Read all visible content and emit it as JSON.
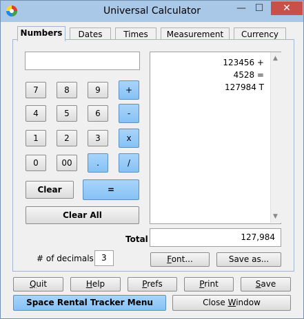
{
  "window": {
    "title": "Universal Calculator",
    "minimize_glyph": "—",
    "maximize_glyph": "☐",
    "close_glyph": "✕"
  },
  "tabs": [
    {
      "label": "Numbers",
      "active": true
    },
    {
      "label": "Dates",
      "active": false
    },
    {
      "label": "Times",
      "active": false
    },
    {
      "label": "Measurement",
      "active": false
    },
    {
      "label": "Currency",
      "active": false
    }
  ],
  "entry": {
    "value": ""
  },
  "keypad": {
    "k7": "7",
    "k8": "8",
    "k9": "9",
    "plus": "+",
    "k4": "4",
    "k5": "5",
    "k6": "6",
    "minus": "-",
    "k1": "1",
    "k2": "2",
    "k3": "3",
    "times": "x",
    "k0": "0",
    "k00": "00",
    "dot": ".",
    "divide": "/",
    "clear": "Clear",
    "equals": "=",
    "clear_all": "Clear All"
  },
  "tape": {
    "lines": [
      "123456 +",
      "4528 =",
      "127984 T"
    ]
  },
  "total": {
    "label": "Total",
    "value": "127,984"
  },
  "decimals": {
    "label": "# of decimals",
    "value": "3"
  },
  "tape_buttons": {
    "font_first": "F",
    "font_rest": "ont...",
    "save_as": "Save as..."
  },
  "bottom": {
    "quit": {
      "first": "Q",
      "rest": "uit"
    },
    "help": {
      "first": "H",
      "rest": "elp"
    },
    "prefs": {
      "first": "P",
      "rest": "refs"
    },
    "print": {
      "first": "P",
      "rest": "rint"
    },
    "save": {
      "first": "S",
      "rest": "ave"
    },
    "menu": "Space Rental Tracker Menu",
    "close_window": {
      "pre": "Close ",
      "key": "W",
      "rest": "indow"
    }
  },
  "colors": {
    "accent_button": "#86c2f5",
    "title_bar": "#a9c7e6",
    "close_button": "#c7504b"
  }
}
